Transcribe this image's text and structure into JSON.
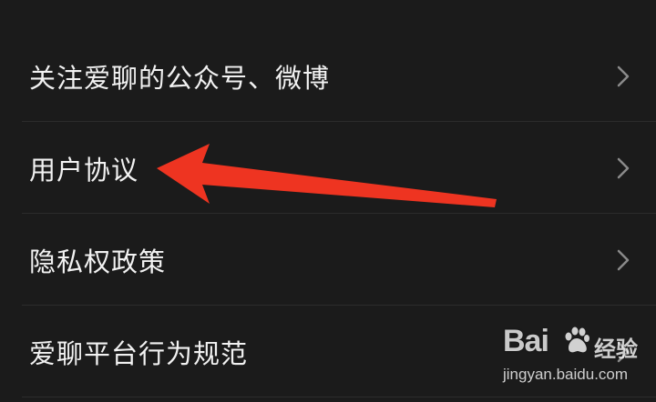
{
  "menu": {
    "items": [
      {
        "label": "关注爱聊的公众号、微博"
      },
      {
        "label": "用户协议"
      },
      {
        "label": "隐私权政策"
      },
      {
        "label": "爱聊平台行为规范"
      }
    ]
  },
  "annotation": {
    "arrow_color": "#ee3421",
    "arrow_target": "menu-item-user-agreement"
  },
  "watermark": {
    "brand_left": "Bai",
    "brand_right": "经验",
    "url": "jingyan.baidu.com"
  },
  "colors": {
    "background": "#1b1b1b",
    "text": "#f2f2f2",
    "chevron": "#8a8a8a",
    "divider": "#2c2c2c"
  }
}
